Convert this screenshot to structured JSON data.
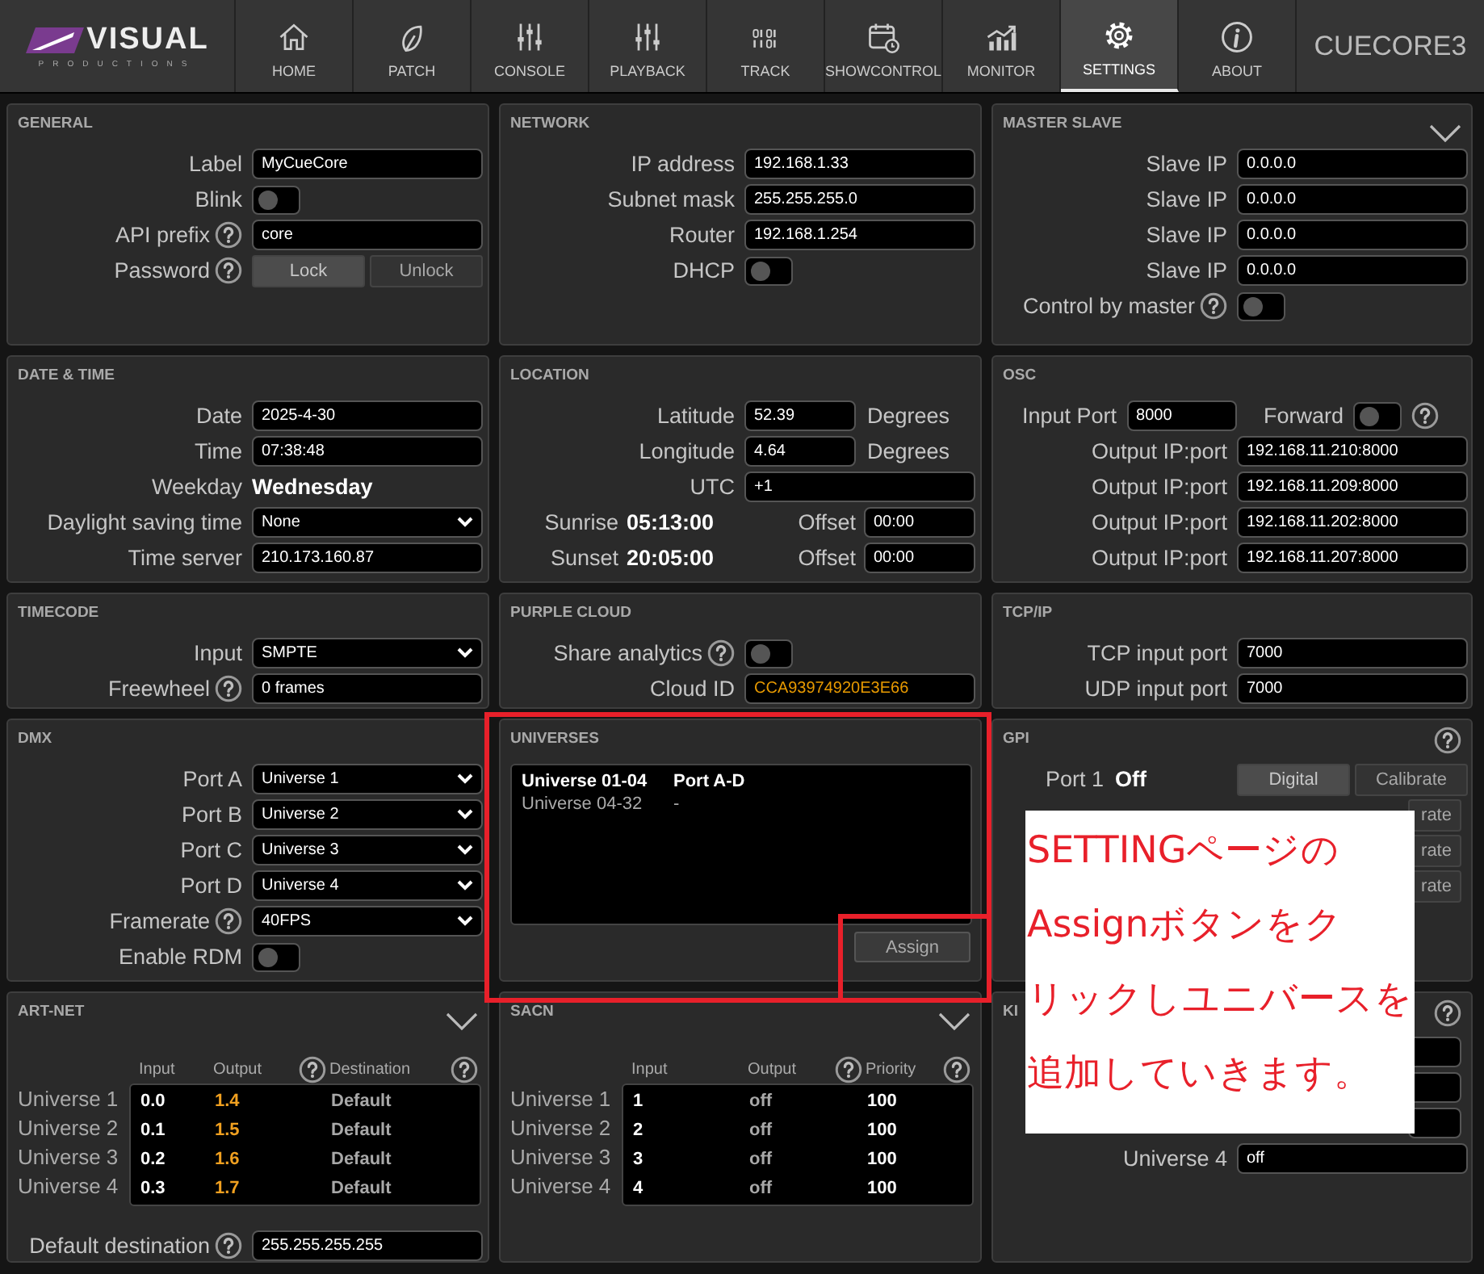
{
  "nav": {
    "logo_word": "VISUAL",
    "logo_tagline": "PRODUCTIONS",
    "device": "CUECORE3",
    "tabs": [
      {
        "label": "HOME",
        "selected": false
      },
      {
        "label": "PATCH",
        "selected": false
      },
      {
        "label": "CONSOLE",
        "selected": false
      },
      {
        "label": "PLAYBACK",
        "selected": false
      },
      {
        "label": "TRACK",
        "selected": false
      },
      {
        "label": "SHOWCONTROL",
        "selected": false
      },
      {
        "label": "MONITOR",
        "selected": false
      },
      {
        "label": "SETTINGS",
        "selected": true
      },
      {
        "label": "ABOUT",
        "selected": false
      }
    ]
  },
  "panels": [
    {
      "title": "GENERAL",
      "kind": "form",
      "rows": [
        {
          "kind": "field",
          "label": "Label",
          "value": "MyCueCore"
        },
        {
          "kind": "toggle",
          "label": "Blink",
          "on": false
        },
        {
          "kind": "field",
          "label": "API prefix",
          "value": "core",
          "help": true
        },
        {
          "kind": "buttons",
          "label": "Password",
          "help": true,
          "buttons": [
            {
              "label": "Lock",
              "selected": true
            },
            {
              "label": "Unlock",
              "selected": false
            }
          ]
        }
      ]
    },
    {
      "title": "NETWORK",
      "kind": "form",
      "rows": [
        {
          "kind": "field",
          "label": "IP address",
          "value": "192.168.1.33"
        },
        {
          "kind": "field",
          "label": "Subnet mask",
          "value": "255.255.255.0"
        },
        {
          "kind": "field",
          "label": "Router",
          "value": "192.168.1.254"
        },
        {
          "kind": "toggle",
          "label": "DHCP",
          "on": false
        }
      ]
    },
    {
      "title": "MASTER SLAVE",
      "kind": "form",
      "collapsible": true,
      "rows": [
        {
          "kind": "field",
          "label": "Slave IP",
          "value": "0.0.0.0"
        },
        {
          "kind": "field",
          "label": "Slave IP",
          "value": "0.0.0.0"
        },
        {
          "kind": "field",
          "label": "Slave IP",
          "value": "0.0.0.0"
        },
        {
          "kind": "field",
          "label": "Slave IP",
          "value": "0.0.0.0"
        },
        {
          "kind": "toggle",
          "label": "Control by master",
          "on": false,
          "help": true
        }
      ]
    },
    {
      "title": "DATE & TIME",
      "kind": "form",
      "rows": [
        {
          "kind": "field",
          "label": "Date",
          "value": "2025-4-30"
        },
        {
          "kind": "field",
          "label": "Time",
          "value": "07:38:48"
        },
        {
          "kind": "info",
          "label": "Weekday",
          "value": "Wednesday"
        },
        {
          "kind": "select",
          "label": "Daylight saving time",
          "value": "None"
        },
        {
          "kind": "field",
          "label": "Time server",
          "value": "210.173.160.87"
        }
      ]
    },
    {
      "title": "LOCATION",
      "kind": "form",
      "rows": [
        {
          "kind": "field",
          "label": "Latitude",
          "value": "52.39",
          "unit": "Degrees"
        },
        {
          "kind": "field",
          "label": "Longitude",
          "value": "4.64",
          "unit": "Degrees"
        },
        {
          "kind": "field",
          "label": "UTC",
          "value": "+1"
        },
        {
          "kind": "sun",
          "label": "Sunrise",
          "value": "05:13:00",
          "offset_label": "Offset",
          "offset_value": "00:00"
        },
        {
          "kind": "sun",
          "label": "Sunset",
          "value": "20:05:00",
          "offset_label": "Offset",
          "offset_value": "00:00"
        }
      ]
    },
    {
      "title": "OSC",
      "kind": "form",
      "rows": [
        {
          "kind": "port",
          "label": "Input Port",
          "value": "8000",
          "toggle_label": "Forward",
          "on": false,
          "help": true
        },
        {
          "kind": "field",
          "label": "Output IP:port",
          "value": "192.168.11.210:8000"
        },
        {
          "kind": "field",
          "label": "Output IP:port",
          "value": "192.168.11.209:8000"
        },
        {
          "kind": "field",
          "label": "Output IP:port",
          "value": "192.168.11.202:8000"
        },
        {
          "kind": "field",
          "label": "Output IP:port",
          "value": "192.168.11.207:8000"
        }
      ]
    },
    {
      "title": "TIMECODE",
      "kind": "form",
      "rows": [
        {
          "kind": "select",
          "label": "Input",
          "value": "SMPTE"
        },
        {
          "kind": "field",
          "label": "Freewheel",
          "value": "0 frames",
          "help": true
        }
      ]
    },
    {
      "title": "PURPLE CLOUD",
      "kind": "form",
      "rows": [
        {
          "kind": "toggle",
          "label": "Share analytics",
          "on": false,
          "help": true
        },
        {
          "kind": "field",
          "label": "Cloud ID",
          "value": "CCA93974920E3E66",
          "accent": true
        }
      ]
    },
    {
      "title": "TCP/IP",
      "kind": "form",
      "rows": [
        {
          "kind": "field",
          "label": "TCP input port",
          "value": "7000"
        },
        {
          "kind": "field",
          "label": "UDP input port",
          "value": "7000"
        }
      ]
    },
    {
      "title": "DMX",
      "kind": "form",
      "rows": [
        {
          "kind": "select",
          "label": "Port A",
          "value": "Universe 1"
        },
        {
          "kind": "select",
          "label": "Port B",
          "value": "Universe 2"
        },
        {
          "kind": "select",
          "label": "Port C",
          "value": "Universe 3"
        },
        {
          "kind": "select",
          "label": "Port D",
          "value": "Universe 4"
        },
        {
          "kind": "select",
          "label": "Framerate",
          "value": "40FPS",
          "help": true
        },
        {
          "kind": "toggle",
          "label": "Enable RDM",
          "on": false
        }
      ]
    },
    {
      "title": "UNIVERSES",
      "kind": "universes",
      "list": [
        {
          "name": "Universe 01-04",
          "ports": "Port A-D",
          "selected": true
        },
        {
          "name": "Universe 04-32",
          "ports": "-",
          "selected": false
        }
      ],
      "action": "Assign"
    },
    {
      "title": "GPI",
      "kind": "form",
      "help": true,
      "rows": [
        {
          "kind": "gpi",
          "label": "Port 1",
          "state": "Off",
          "buttons": [
            {
              "label": "Digital",
              "selected": true
            },
            {
              "label": "Calibrate",
              "selected": false
            }
          ]
        },
        {
          "kind": "covered",
          "text": "rate"
        },
        {
          "kind": "covered",
          "text": "rate"
        },
        {
          "kind": "covered",
          "text": "rate"
        }
      ]
    },
    {
      "title": "ART-NET",
      "kind": "table",
      "collapsible": true,
      "columns": [
        {
          "label": "Input",
          "color": "#ffffff"
        },
        {
          "label": "Output",
          "help": true,
          "color": "#f0a020"
        },
        {
          "label": "Destination",
          "help": true,
          "color": "#a8a8a8"
        }
      ],
      "rows": [
        {
          "label": "Universe 1",
          "cells": [
            "0.0",
            "1.4",
            "Default"
          ]
        },
        {
          "label": "Universe 2",
          "cells": [
            "0.1",
            "1.5",
            "Default"
          ]
        },
        {
          "label": "Universe 3",
          "cells": [
            "0.2",
            "1.6",
            "Default"
          ]
        },
        {
          "label": "Universe 4",
          "cells": [
            "0.3",
            "1.7",
            "Default"
          ]
        }
      ],
      "footer": {
        "label": "Default destination",
        "value": "255.255.255.255",
        "help": true
      }
    },
    {
      "title": "SACN",
      "kind": "table",
      "collapsible": true,
      "columns": [
        {
          "label": "Input",
          "color": "#ffffff"
        },
        {
          "label": "Output",
          "help": true,
          "color": "#a8a8a8"
        },
        {
          "label": "Priority",
          "help": true,
          "color": "#ffffff"
        }
      ],
      "rows": [
        {
          "label": "Universe 1",
          "cells": [
            "1",
            "off",
            "100"
          ]
        },
        {
          "label": "Universe 2",
          "cells": [
            "2",
            "off",
            "100"
          ]
        },
        {
          "label": "Universe 3",
          "cells": [
            "3",
            "off",
            "100"
          ]
        },
        {
          "label": "Universe 4",
          "cells": [
            "4",
            "off",
            "100"
          ]
        }
      ]
    },
    {
      "title": "KI",
      "kind": "form",
      "help": true,
      "rows": [
        {
          "kind": "covered"
        },
        {
          "kind": "covered"
        },
        {
          "kind": "covered"
        },
        {
          "kind": "field",
          "label": "Universe 4",
          "value": "off"
        }
      ]
    }
  ],
  "annotation": {
    "lines": [
      "SETTINGページの",
      "Assignボタンをク",
      "リックしユニバースを",
      "追加していきます。"
    ]
  }
}
